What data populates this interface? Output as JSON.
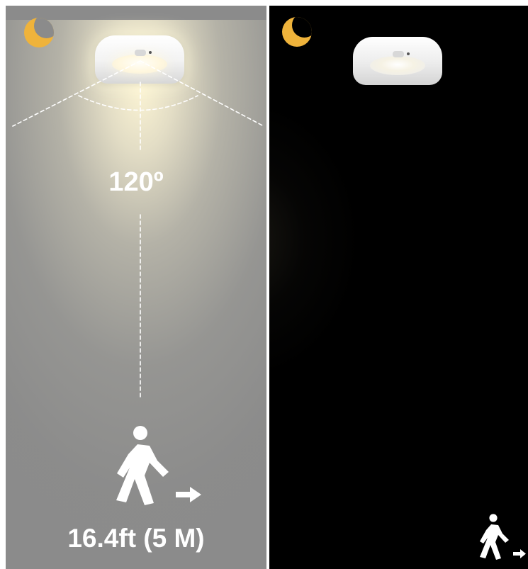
{
  "left_panel": {
    "moon_icon": "moon-icon",
    "lamp_icon": "lamp-icon",
    "walker_icon": "walking-person-icon",
    "arrow_icon": "arrow-right-icon",
    "angle": "120º",
    "distance": "16.4ft (5 M)"
  },
  "right_panel": {
    "moon_icon": "moon-icon",
    "lamp_icon": "lamp-icon",
    "walker_icon": "walking-person-icon",
    "arrow_icon": "arrow-right-icon"
  },
  "colors": {
    "accent_moon": "#efb33b",
    "left_background": "#8b8b8b",
    "right_background": "#000000"
  }
}
